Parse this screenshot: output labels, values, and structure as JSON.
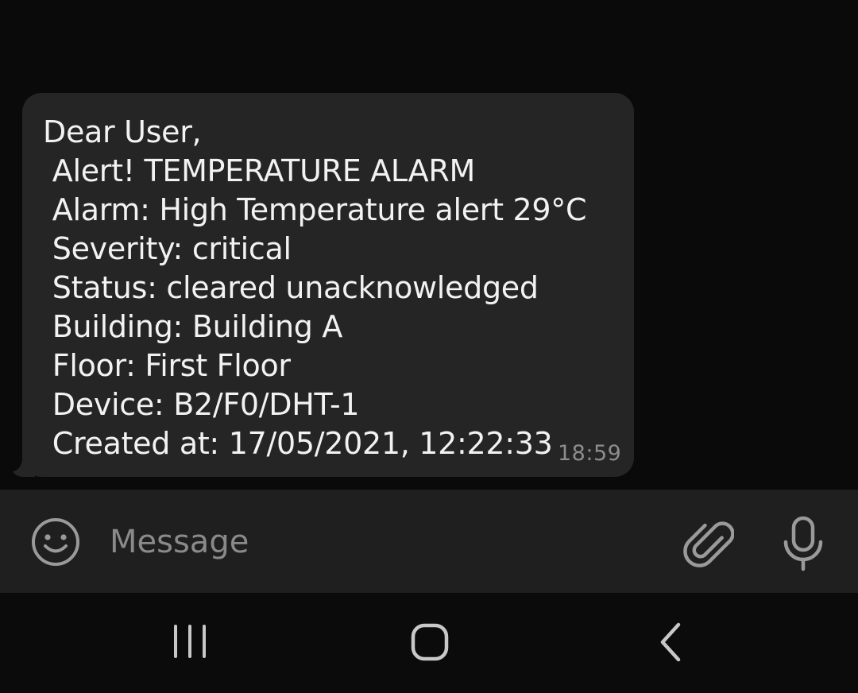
{
  "message": {
    "lines": [
      "Dear User,",
      " Alert! TEMPERATURE ALARM",
      " Alarm: High Temperature alert 29°C",
      " Severity: critical",
      " Status: cleared unacknowledged",
      " Building: Building A",
      " Floor: First Floor",
      " Device: B2/F0/DHT-1",
      " Created at: 17/05/2021, 12:22:33"
    ],
    "time": "18:59"
  },
  "composer": {
    "placeholder": "Message",
    "emoji_icon": "smiley-face-icon",
    "attach_icon": "paperclip-icon",
    "mic_icon": "microphone-icon"
  },
  "navigation": {
    "recent_icon": "recent-apps-icon",
    "home_icon": "home-icon",
    "back_icon": "back-chevron-icon"
  },
  "colors": {
    "bubble": "#252525",
    "background": "#0a0a0a",
    "input_bar": "#1f1f1f",
    "icon_gray": "#9a9a9a"
  }
}
